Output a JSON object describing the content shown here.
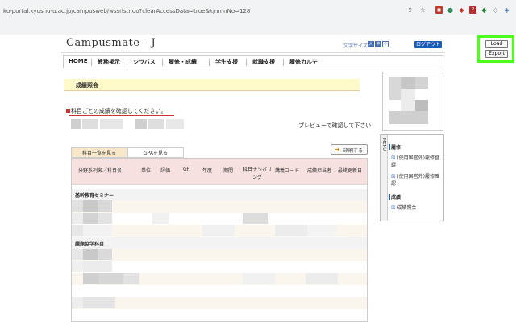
{
  "browser": {
    "url": "ku-portal.kyushu-u.ac.jp/campusweb/wssrlstr.do?clearAccessData=true&kjnmnNo=128"
  },
  "extension": {
    "load_label": "Load",
    "export_label": "Export"
  },
  "header": {
    "logo": "Campusmate - J",
    "font_size_label": "文字サイズ",
    "font_size_options": [
      "大",
      "中",
      "小"
    ],
    "logout_label": "ログアウト"
  },
  "nav": {
    "items": [
      "HOME",
      "教務掲示",
      "シラバス",
      "履修・成績",
      "学生支援",
      "就職支援",
      "履修カルテ"
    ]
  },
  "main": {
    "page_title": "成績照会",
    "instruction": "科目ごとの成績を確認してください。",
    "preview_note": "プレビューで確認して下さい",
    "tabs": [
      "科目一覧を見る",
      "GPAを見る"
    ],
    "print_label": "印刷する",
    "table": {
      "headers": [
        "分野系列名／科目名",
        "単位",
        "評価",
        "GP",
        "年度",
        "期間",
        "科目ナンバリング",
        "講義コード",
        "成績担当者",
        "最終更新日"
      ],
      "groups": [
        "基幹教育セミナー",
        "課題協学科目"
      ]
    }
  },
  "sidebar": {
    "vertical_tab": "MENU",
    "sections": [
      {
        "heading": "履修",
        "links": [
          "(使用国営外)履修登録",
          "(使用国営外)履修確認"
        ]
      },
      {
        "heading": "成績",
        "links": [
          "成績照会"
        ]
      }
    ]
  },
  "colors": {
    "highlight_border": "#4cff1a",
    "accent_blue": "#1d5db5",
    "title_bg": "#fff8c9",
    "header_bg": "#f6e0e0"
  }
}
